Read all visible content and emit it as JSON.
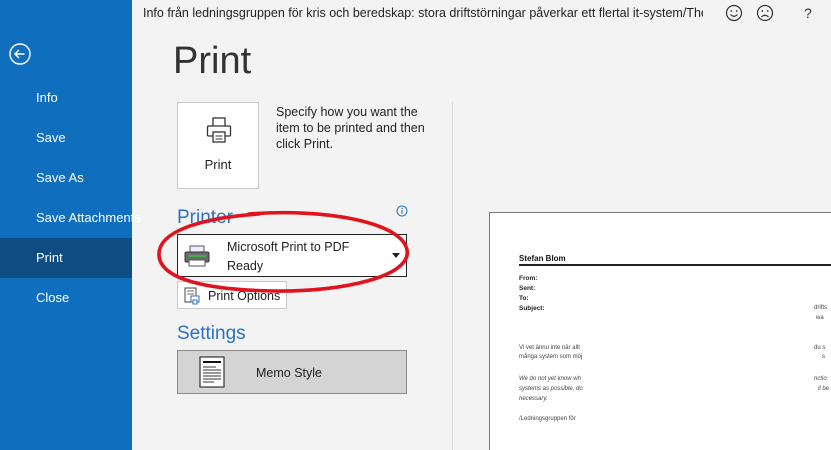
{
  "window": {
    "title": "Info från ledningsgruppen för kris och beredskap: stora driftstörningar påverkar ett flertal it-system/The d...",
    "help_label": "?"
  },
  "nav": {
    "items": [
      {
        "label": "Info"
      },
      {
        "label": "Save"
      },
      {
        "label": "Save As"
      },
      {
        "label": "Save Attachments"
      },
      {
        "label": "Print"
      },
      {
        "label": "Close"
      }
    ]
  },
  "page": {
    "title": "Print"
  },
  "print_button": {
    "label": "Print",
    "description": "Specify how you want the item to be printed and then click Print."
  },
  "printer": {
    "heading": "Printer",
    "name": "Microsoft Print to PDF",
    "status": "Ready",
    "options_label": "Print Options"
  },
  "settings": {
    "heading": "Settings",
    "style": "Memo Style"
  },
  "preview": {
    "sender": "Stefan Blom",
    "fields": [
      "From:",
      "Sent:",
      "To:",
      "Subject:"
    ],
    "lines": [
      {
        "text": "Vi vet ännu inte när allt",
        "italic": false
      },
      {
        "text": "många system som möj",
        "italic": false
      },
      {
        "text": "We do not yet know wh",
        "italic": true
      },
      {
        "text": "systems as possible, do",
        "italic": true
      },
      {
        "text": "necessary.",
        "italic": true
      },
      {
        "text": "/Ledningsgruppen för",
        "italic": false
      }
    ],
    "right_fragments": [
      "drifts",
      "wa",
      "du s",
      "s",
      "nctio",
      "ll be"
    ]
  },
  "colors": {
    "sidebar": "#106ebe",
    "sidebar_active": "#0f4c81",
    "accent": "#2b71c4",
    "annotation": "#e0141e"
  }
}
